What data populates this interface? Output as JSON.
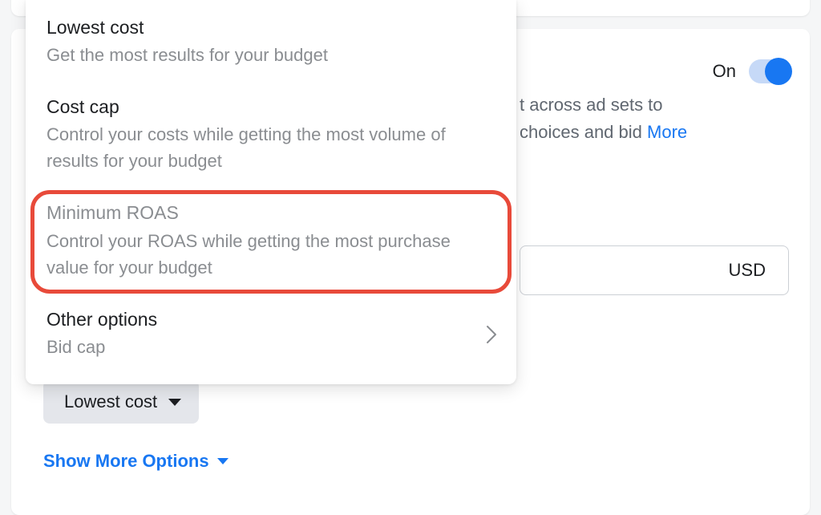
{
  "toggle": {
    "label": "On"
  },
  "description": {
    "line1": "t across ad sets to",
    "line2": " choices and bid",
    "more": "More"
  },
  "currency": {
    "code": "USD"
  },
  "selected_strategy": {
    "label": "Lowest cost"
  },
  "show_more": {
    "label": "Show More Options"
  },
  "menu": {
    "lowest_cost": {
      "title": "Lowest cost",
      "desc": "Get the most results for your budget"
    },
    "cost_cap": {
      "title": "Cost cap",
      "desc": "Control your costs while getting the most volume of results for your budget"
    },
    "min_roas": {
      "title": "Minimum ROAS",
      "desc": "Control your ROAS while getting the most purchase value for your budget"
    },
    "other": {
      "title": "Other options",
      "desc": "Bid cap"
    }
  }
}
